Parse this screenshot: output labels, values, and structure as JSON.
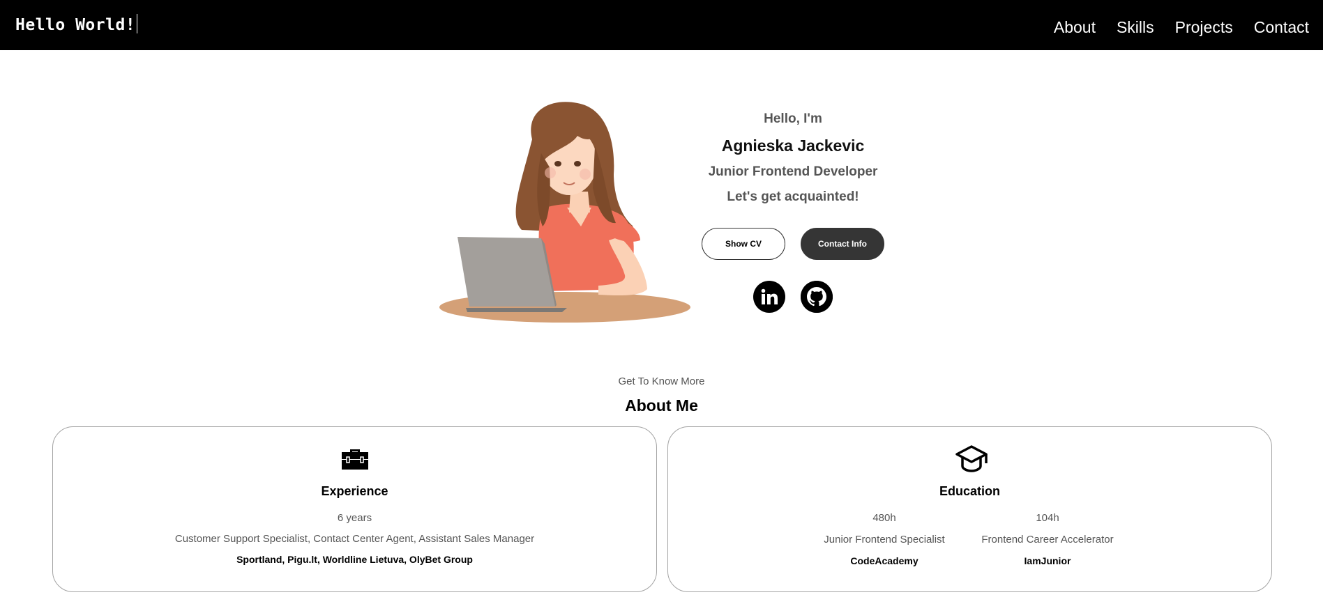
{
  "header": {
    "logo": "Hello World!",
    "nav": [
      "About",
      "Skills",
      "Projects",
      "Contact"
    ]
  },
  "hero": {
    "greeting": "Hello, I'm",
    "name": "Agnieska Jackevic",
    "role": "Junior Frontend Developer",
    "tagline": "Let's get acquainted!",
    "buttons": {
      "cv": "Show CV",
      "contact": "Contact Info"
    },
    "socials": [
      "linkedin-icon",
      "github-icon"
    ]
  },
  "about": {
    "subtitle": "Get To Know More",
    "title": "About Me",
    "experience": {
      "icon": "briefcase-icon",
      "title": "Experience",
      "years": "6 years",
      "roles": "Customer Support Specialist, Contact Center Agent, Assistant Sales Manager",
      "companies": "Sportland, Pigu.lt, Worldline Lietuva, OlyBet Group"
    },
    "education": {
      "icon": "graduation-cap-icon",
      "title": "Education",
      "items": [
        {
          "hours": "480h",
          "course": "Junior Frontend Specialist",
          "school": "CodeAcademy"
        },
        {
          "hours": "104h",
          "course": "Frontend Career Accelerator",
          "school": "IamJunior"
        }
      ]
    }
  },
  "colors": {
    "header_bg": "#000000",
    "dark_button": "#353535",
    "card_border": "#a3a3a3",
    "muted_text": "#555555"
  }
}
